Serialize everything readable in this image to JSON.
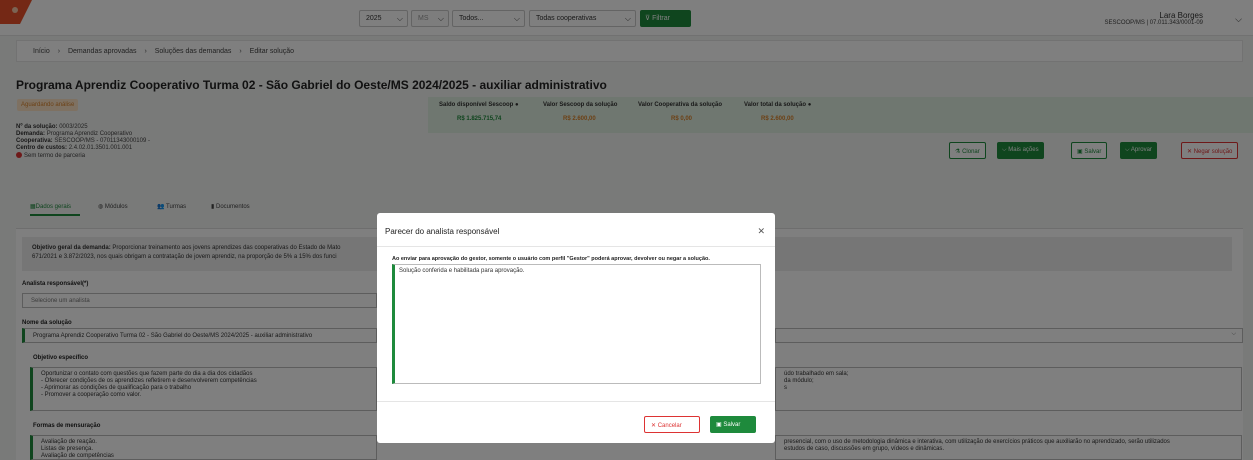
{
  "topbar": {
    "year": "2025",
    "state": "MS",
    "type": "Todos...",
    "cooperative": "Todas cooperativas",
    "filter_label": "Filtrar",
    "user_name": "Lara Borges",
    "user_org": "SESCOOP/MS | 07.011.343/0001-09"
  },
  "breadcrumb": [
    "Início",
    "Demandas aprovadas",
    "Soluções das demandas",
    "Editar solução"
  ],
  "page": {
    "title": "Programa Aprendiz Cooperativo Turma 02 - São Gabriel do Oeste/MS 2024/2025 - auxiliar administrativo",
    "status": "Aguardando análise",
    "info": [
      {
        "label": "Nº da solução:",
        "value": "0003/2025"
      },
      {
        "label": "Demanda:",
        "value": "Programa Aprendiz Cooperativo"
      },
      {
        "label": "Cooperativa:",
        "value": "SESCOOP/MS - 07011343000109 -"
      },
      {
        "label": "Centro de custos:",
        "value": "2.4.02.01.3501.001.001"
      }
    ],
    "no_partnership": "Sem termo de parceria"
  },
  "saldo": {
    "labels": [
      "Saldo disponível Sescoop",
      "Valor Sescoop da solução",
      "Valor Cooperativa da solução",
      "Valor total da solução"
    ],
    "values": [
      "R$ 1.825.715,74",
      "R$ 2.600,00",
      "R$ 0,00",
      "R$ 2.600,00"
    ],
    "colors": [
      "#1e8a3c",
      "#d9822b",
      "#d9822b",
      "#d9822b"
    ]
  },
  "actions": {
    "clone": "Clonar",
    "more": "Mais ações",
    "save": "Salvar",
    "approve": "Aprovar",
    "deny": "Negar solução"
  },
  "tabs": [
    "Dados gerais",
    "Módulos",
    "Turmas",
    "Documentos"
  ],
  "form": {
    "objective_label": "Objetivo geral da demanda:",
    "objective_text": "Proporcionar treinamento aos jovens aprendizes das cooperativas do Estado de Mato",
    "objective_text2": "671/2021 e 3.872/2023, nos quais obrigam a contratação de jovem aprendiz, na proporção de 5% a 15% dos funci",
    "analyst_label": "Analista responsável(*)",
    "analyst_placeholder": "Selecione um analista",
    "solution_name_label": "Nome da solução",
    "solution_name": "Programa Aprendiz Cooperativo Turma 02 - São Gabriel do Oeste/MS 2024/2025 - auxiliar administrativo",
    "specific_label": "Objetivo específico",
    "specific_text": "Oportunizar o contato com questões que fazem parte do dia a dia dos cidadãos\n- Oferecer condições de os aprendizes refletirem e desenvolverem competências\n- Aprimorar as condições de qualificação para o trabalho\n- Promover a cooperação como valor.",
    "right_text": "údo trabalhado em sala;\nda módulo;\ns",
    "measure_label": "Formas de mensuração",
    "measure_text": "Avaliação de reação.\nListas de presença.\nAvaliação de competências",
    "method_text": "presencial, com o uso de metodologia dinâmica e interativa, com utilização de exercícios práticos que auxiliarão no aprendizado, serão utilizados\nestudos de caso, discussões em grupo, vídeos e dinâmicas."
  },
  "modal": {
    "title": "Parecer do analista responsável",
    "note": "Ao enviar para aprovação do gestor, somente o usuário com perfil \"Gestor\" poderá aprovar, devolver ou negar a solução.",
    "text": "Solução conferida e habilitada para aprovação.",
    "cancel": "Cancelar",
    "save": "Salvar"
  },
  "colors": {
    "primary": "#1e8a3c",
    "danger": "#dd3333",
    "warning": "#d9822b"
  }
}
